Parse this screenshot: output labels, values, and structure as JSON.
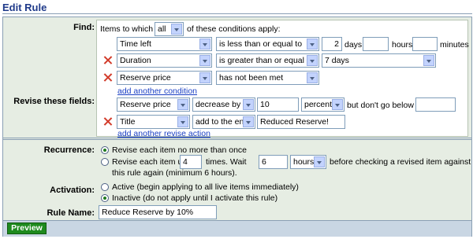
{
  "title": "Edit Rule",
  "labels": {
    "find": "Find:",
    "revise": "Revise these fields:",
    "recurrence": "Recurrence:",
    "activation": "Activation:",
    "rule_name": "Rule Name:"
  },
  "find": {
    "intro": "Items to which",
    "match_mode": "all",
    "outro": "of these conditions apply:",
    "conditions": [
      {
        "field": "Time left",
        "operator": "is less than or equal to",
        "days": "2",
        "days_label": "days",
        "hours": "",
        "hours_label": "hours",
        "minutes": "",
        "minutes_label": "minutes"
      },
      {
        "field": "Duration",
        "operator": "is greater than or equal to",
        "value": "7 days"
      },
      {
        "field": "Reserve price",
        "operator": "has not been met"
      }
    ],
    "add_condition": "add another condition"
  },
  "revise": {
    "actions": [
      {
        "field": "Reserve price",
        "operator": "decrease by",
        "amount": "10",
        "unit": "percent",
        "limit_text": "but don't go below $",
        "limit_value": ""
      },
      {
        "field": "Title",
        "operator": "add to the end",
        "value": "Reduced Reserve!"
      }
    ],
    "add_action": "add another revise action"
  },
  "recurrence": {
    "option_once": "Revise each item no more than once",
    "option_repeat_prefix": "Revise each item up to",
    "repeat_count": "4",
    "times_wait": "times. Wait",
    "wait_value": "6",
    "wait_unit": "hours",
    "option_repeat_suffix": "before checking a revised item against",
    "option_repeat_line2": "this rule again (minimum 6 hours).",
    "selected": "once"
  },
  "activation": {
    "active": "Active (begin applying to all live items immediately)",
    "inactive": "Inactive (do not apply until I activate this rule)",
    "selected": "inactive"
  },
  "rule_name": "Reduce Reserve by 10%",
  "preview_button": "Preview",
  "colors": {
    "title": "#1f3a8a",
    "panel_bg": "#e6ede3",
    "footer_bg": "#c9d6e3",
    "remove_x": "#d23b2a",
    "link": "#1a3fc4",
    "button": "#1e8a1e"
  }
}
